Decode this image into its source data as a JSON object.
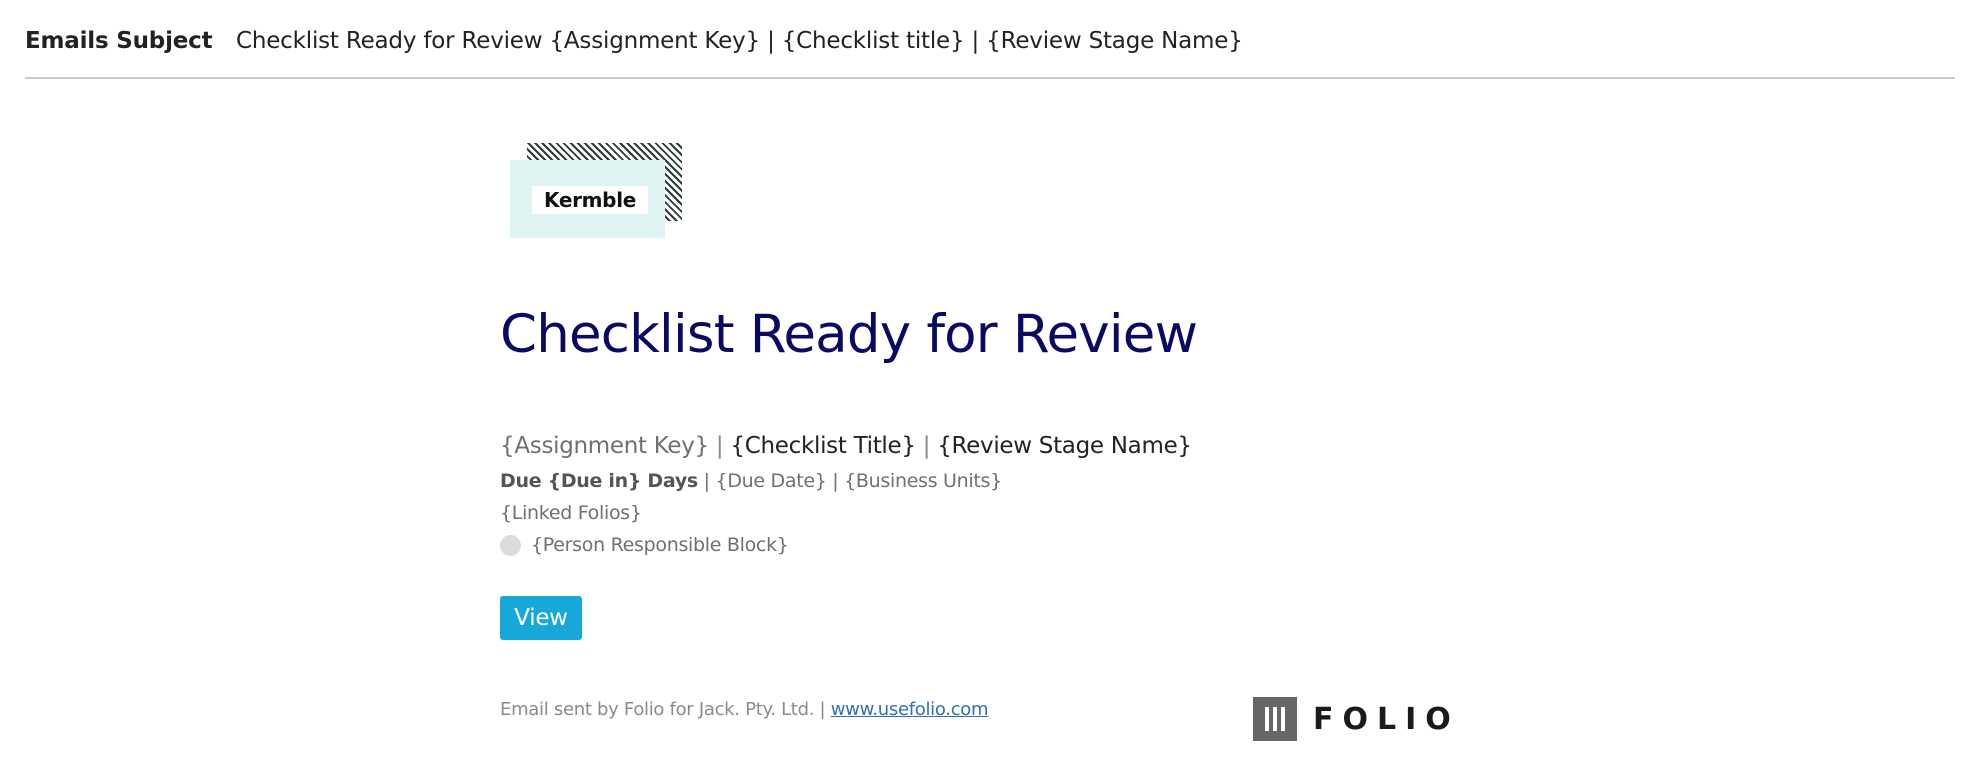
{
  "subject": {
    "label": "Emails Subject",
    "value": "Checklist Ready for Review {Assignment Key} | {Checklist title} | {Review Stage Name}"
  },
  "logo": {
    "brand_text": "Kermble"
  },
  "email": {
    "title": "Checklist Ready for Review",
    "line1": {
      "assignment_key": "{Assignment Key}",
      "separator": "|",
      "checklist_title": "{Checklist Title}",
      "review_stage": "{Review Stage Name}"
    },
    "line2": {
      "due_label": "Due {Due in} Days",
      "separator": "|",
      "due_date": "{Due Date}",
      "business_units": "{Business Units}"
    },
    "linked_folios": "{Linked Folios}",
    "person_block": "{Person Responsible Block}",
    "view_button": "View"
  },
  "footer": {
    "text": "Email sent by Folio for Jack. Pty. Ltd. |",
    "link_text": "www.usefolio.com"
  },
  "folio_logo": {
    "word": "FOLIO"
  },
  "colors": {
    "title": "#0b0a63",
    "button": "#17a8d9",
    "link": "#2f6fb5",
    "logo_card": "#dff3f3"
  }
}
